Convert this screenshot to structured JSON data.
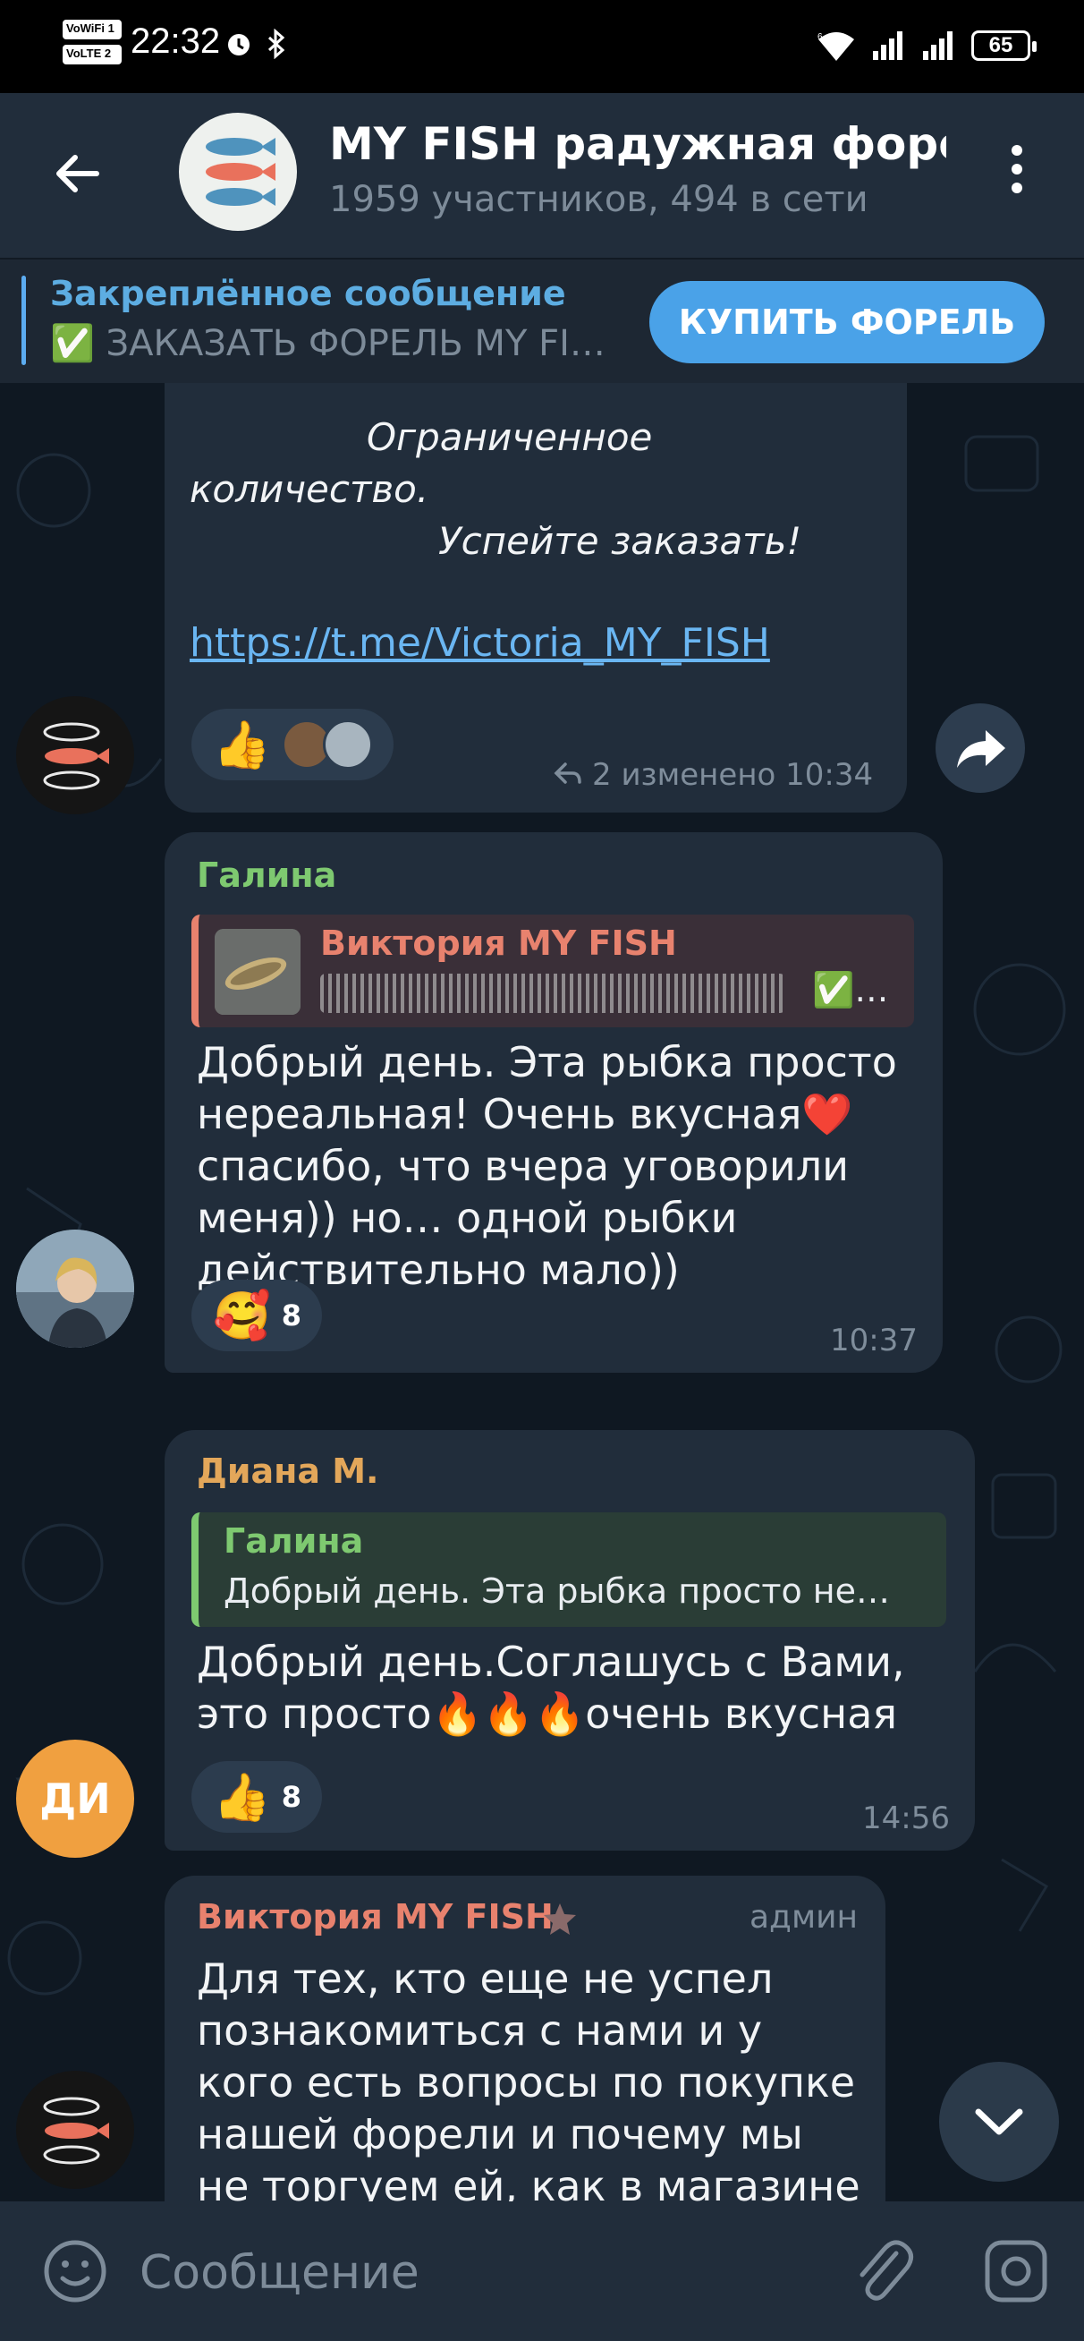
{
  "status_bar": {
    "sim1": "VoWiFi 1",
    "sim2": "VoLTE 2",
    "time": "22:32",
    "battery": "65"
  },
  "header": {
    "title": "MY FISH радужная форел",
    "subtitle": "1959 участников, 494 в сети"
  },
  "pinned": {
    "title": "Закреплённое сообщение",
    "text": "✅ ЗАКАЗАТЬ ФОРЕЛЬ MY FI…",
    "button": "КУПИТЬ ФОРЕЛЬ"
  },
  "messages": [
    {
      "line1": "Ограниченное",
      "line2": "количество.",
      "line3": "Успейте заказать!",
      "link": "https://t.me/Victoria_MY_FISH",
      "reaction_emoji": "👍",
      "meta": "2 изменено 10:34"
    },
    {
      "sender": "Галина",
      "quote_sender": "Виктория MY FISH",
      "quote_check": "✅…",
      "text": "Добрый день. Эта рыбка просто\nнереальная! Очень вкусная❤️\nспасибо, что вчера уговорили\nменя)) но… одной рыбки\nдействительно мало))",
      "reaction_emoji": "🥰",
      "reaction_count": "8",
      "time": "10:37"
    },
    {
      "sender": "Диана М.",
      "avatar_initials": "ДИ",
      "quote_sender": "Галина",
      "quote_text": "Добрый день. Эта рыбка просто не…",
      "text": "Добрый день.Соглашусь с Вами,\nэто просто🔥🔥🔥очень вкусная",
      "reaction_emoji": "👍",
      "reaction_count": "8",
      "time": "14:56"
    },
    {
      "sender": "Виктория MY FISH",
      "badge": "админ",
      "text": "Для тех, кто еще не успел\nпознакомиться с нами и у\nкого есть вопросы по покупке\nнашей форели и почему мы\nне торгуем ей, как в магазине"
    }
  ],
  "input": {
    "placeholder": "Сообщение"
  },
  "colors": {
    "accent": "#4aa2e8",
    "name_galina": "#7ec970",
    "name_diana": "#e3a75a",
    "name_victoria": "#e8826e",
    "bubble": "#212d3b"
  }
}
